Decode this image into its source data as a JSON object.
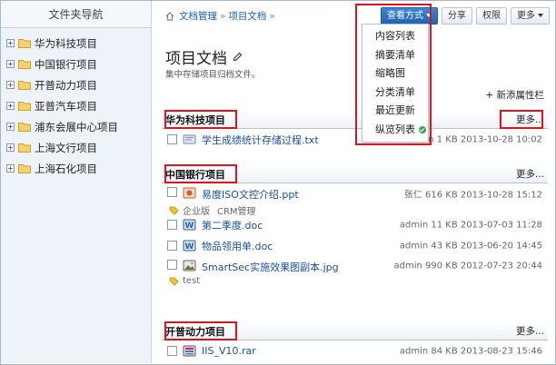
{
  "sidebar": {
    "title": "文件夹导航",
    "items": [
      {
        "label": "华为科技项目"
      },
      {
        "label": "中国银行项目"
      },
      {
        "label": "开普动力项目"
      },
      {
        "label": "亚普汽车项目"
      },
      {
        "label": "浦东会展中心项目"
      },
      {
        "label": "上海文行项目"
      },
      {
        "label": "上海石化项目"
      }
    ]
  },
  "breadcrumb": {
    "items": [
      "文档管理",
      "项目文档"
    ],
    "separator": "»"
  },
  "toolbar": {
    "view_mode": "查看方式",
    "share": "分享",
    "permission": "权限",
    "more": "更多"
  },
  "view_menu": {
    "items": [
      "内容列表",
      "摘要清单",
      "缩略图",
      "分类清单",
      "最近更新",
      "纵览列表"
    ],
    "selected": "纵览列表"
  },
  "page": {
    "title": "项目文档",
    "subtitle": "集中存储项目归档文件。",
    "add_attr": "+ 新添属性栏"
  },
  "sections": [
    {
      "title": "华为科技项目",
      "more": "更多...",
      "files": [
        {
          "name": "学生成绩统计存储过程.txt",
          "meta": "admin 1 KB 2013-10-28 10:02",
          "icon": "txt-file-icon"
        }
      ]
    },
    {
      "title": "中国银行项目",
      "more": "更多...",
      "files": [
        {
          "name": "易度ISO文控介绍.ppt",
          "meta": "张仁 616 KB 2013-10-28 15:12",
          "icon": "ppt-file-icon",
          "tags": [
            "企业版",
            "CRM管理"
          ]
        },
        {
          "name": "第二季度.doc",
          "meta": "admin 11 KB 2013-07-03 11:28",
          "icon": "doc-file-icon"
        },
        {
          "name": "物品领用单.doc",
          "meta": "admin 43 KB 2013-06-20 14:45",
          "icon": "doc-file-icon"
        },
        {
          "name": "SmartSec实施效果图副本.jpg",
          "meta": "admin 990 KB 2012-07-23 20:44",
          "icon": "image-file-icon",
          "tags": [
            "test"
          ]
        }
      ]
    },
    {
      "title": "开普动力项目",
      "more": "更多...",
      "files": [
        {
          "name": "IIS_V10.rar",
          "meta": "admin 84 KB 2013-08-23 15:46",
          "icon": "rar-file-icon"
        }
      ]
    }
  ],
  "colors": {
    "highlight": "#e0141e",
    "link": "#1a4fa3",
    "primary_button": "#1f63b2",
    "sidebar_bg": "#eef3f9"
  }
}
